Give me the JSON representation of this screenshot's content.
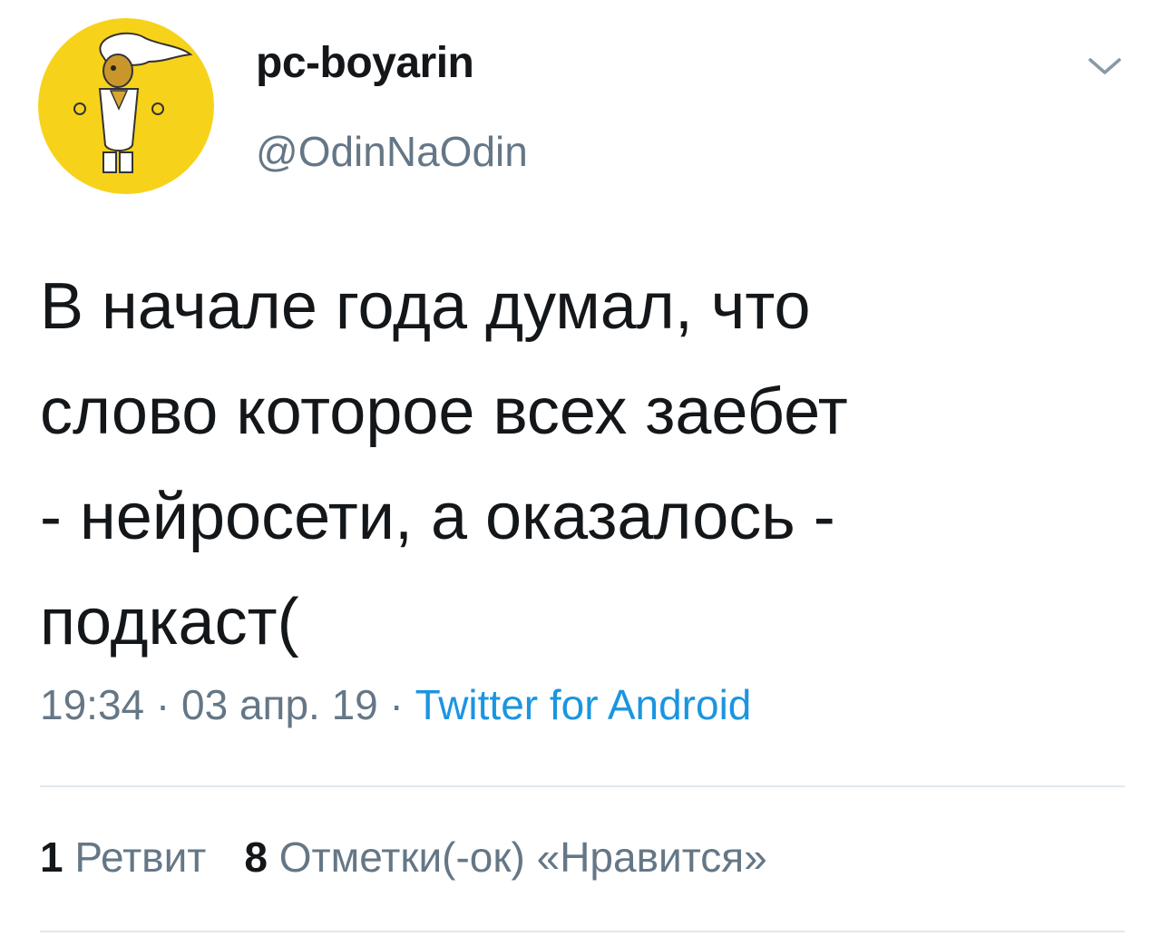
{
  "tweet": {
    "display_name": "pc-boyarin",
    "handle": "@OdinNaOdin",
    "text": "В начале года думал, что\nслово которое всех заебет\n- нейросети, а оказалось -\nподкаст(",
    "time": "19:34",
    "separator": " · ",
    "date": "03 апр. 19",
    "source": "Twitter for Android",
    "stats": {
      "retweets_count": "1",
      "retweets_label": "Ретвит",
      "likes_count": "8",
      "likes_label": "Отметки(-ок) «Нравится»"
    }
  },
  "icons": {
    "avatar": "avatar-image",
    "menu": "chevron-down-icon"
  },
  "colors": {
    "avatar_bg": "#f7d21b",
    "secondary_text": "#657786",
    "link": "#1b95e0",
    "divider": "#e1e8ed"
  }
}
